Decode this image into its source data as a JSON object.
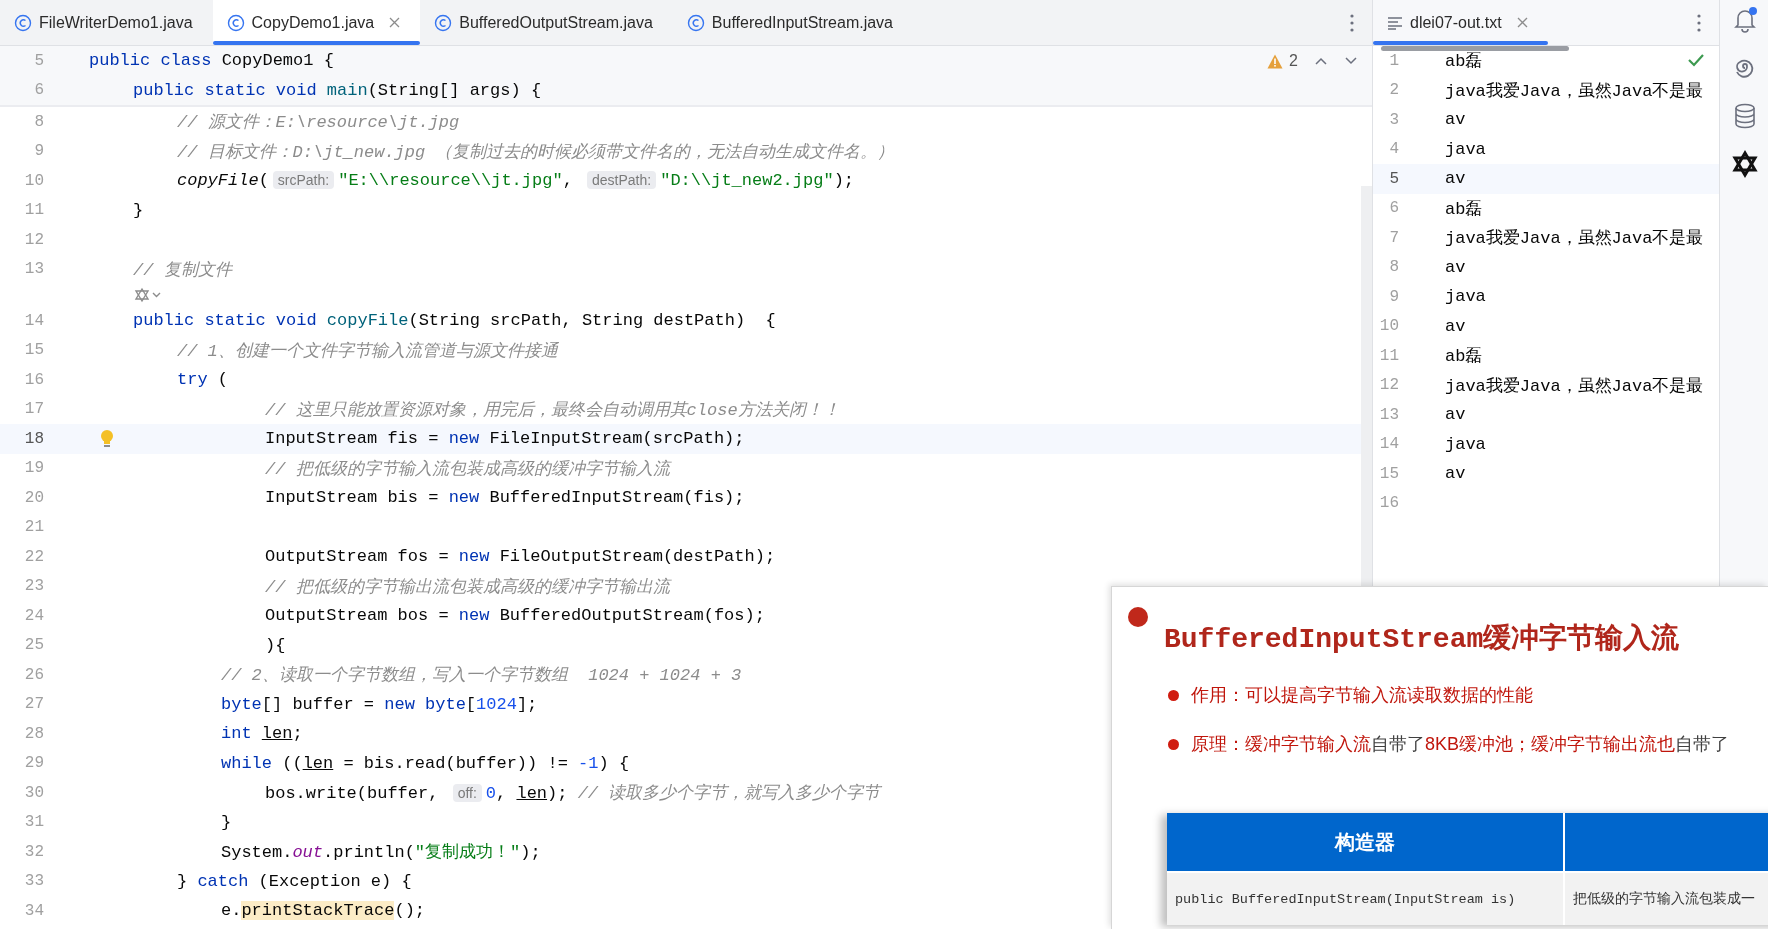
{
  "editor": {
    "tabs": [
      {
        "label": "FileWriterDemo1.java",
        "selected": false,
        "closable": false
      },
      {
        "label": "CopyDemo1.java",
        "selected": true,
        "closable": true
      },
      {
        "label": "BufferedOutputStream.java",
        "selected": false,
        "closable": false
      },
      {
        "label": "BufferedInputStream.java",
        "selected": false,
        "closable": false
      }
    ],
    "warnings": "2",
    "sticky_lines": [
      {
        "kind": "code",
        "number": "5",
        "tokens": [
          {
            "kind": "kw",
            "text": "public class "
          },
          {
            "kind": "t",
            "text": "CopyDemo1 {"
          }
        ]
      },
      {
        "kind": "indent",
        "children": [
          {
            "kind": "code",
            "number": "6",
            "tokens": [
              {
                "kind": "kw",
                "text": "public static void "
              },
              {
                "kind": "fn",
                "text": "main"
              },
              {
                "kind": "t",
                "text": "(String[] args) {"
              }
            ]
          }
        ]
      }
    ],
    "lines": [
      {
        "kind": "indent",
        "children": [
          {
            "kind": "indent",
            "children": [
              {
                "kind": "code",
                "number": "8",
                "current": false,
                "tokens": [
                  {
                    "kind": "cm",
                    "text": "// 源文件：E:\\resource\\jt.jpg"
                  }
                ]
              },
              {
                "kind": "code",
                "number": "9",
                "current": false,
                "tokens": [
                  {
                    "kind": "cm",
                    "text": "// 目标文件：D:\\jt_new.jpg （复制过去的时候必须带文件名的，无法自动生成文件名。）"
                  }
                ]
              },
              {
                "kind": "code",
                "number": "10",
                "current": false,
                "tokens": [
                  {
                    "kind": "it",
                    "text": "copyFile"
                  },
                  {
                    "kind": "t",
                    "text": "("
                  },
                  {
                    "kind": "hint",
                    "text": "srcPath:"
                  },
                  {
                    "kind": "str",
                    "text": "\"E:\\\\resource\\\\jt.jpg\""
                  },
                  {
                    "kind": "t",
                    "text": ", "
                  },
                  {
                    "kind": "hint",
                    "text": "destPath:"
                  },
                  {
                    "kind": "str",
                    "text": "\"D:\\\\jt_new2.jpg\""
                  },
                  {
                    "kind": "t",
                    "text": ");"
                  }
                ]
              }
            ]
          },
          {
            "kind": "code",
            "number": "11",
            "current": false,
            "tokens": [
              {
                "kind": "t",
                "text": "}"
              }
            ]
          },
          {
            "kind": "code",
            "number": "12",
            "current": false
          },
          {
            "kind": "code",
            "number": "13",
            "current": false,
            "tokens": [
              {
                "kind": "cm",
                "text": "// 复制文件"
              }
            ]
          },
          {
            "kind": "inlay"
          },
          {
            "kind": "code",
            "number": "14",
            "current": false,
            "tokens": [
              {
                "kind": "kw",
                "text": "public static void "
              },
              {
                "kind": "fn",
                "text": "copyFile"
              },
              {
                "kind": "t",
                "text": "(String srcPath, String destPath)  {"
              }
            ]
          },
          {
            "kind": "indent",
            "children": [
              {
                "kind": "code",
                "number": "15",
                "current": false,
                "tokens": [
                  {
                    "kind": "cm",
                    "text": "// 1、创建一个文件字节输入流管道与源文件接通"
                  }
                ]
              },
              {
                "kind": "code",
                "number": "16",
                "current": false,
                "tokens": [
                  {
                    "kind": "kw",
                    "text": "try"
                  },
                  {
                    "kind": "t",
                    "text": " ("
                  }
                ]
              },
              {
                "kind": "indent",
                "children": [
                  {
                    "kind": "indent",
                    "children": [
                      {
                        "kind": "code",
                        "number": "17",
                        "current": false,
                        "tokens": [
                          {
                            "kind": "cm",
                            "text": "// 这里只能放置资源对象，用完后，最终会自动调用其close方法关闭！！"
                          }
                        ]
                      },
                      {
                        "kind": "code",
                        "number": "18",
                        "current": true,
                        "tokens": [
                          {
                            "kind": "t",
                            "text": "InputStream fis = "
                          },
                          {
                            "kind": "kw",
                            "text": "new"
                          },
                          {
                            "kind": "t",
                            "text": " FileInputStream(srcPath);"
                          }
                        ]
                      },
                      {
                        "kind": "code",
                        "number": "19",
                        "current": false,
                        "tokens": [
                          {
                            "kind": "cm",
                            "text": "// 把低级的字节输入流包装成高级的缓冲字节输入流"
                          }
                        ]
                      },
                      {
                        "kind": "code",
                        "number": "20",
                        "current": false,
                        "tokens": [
                          {
                            "kind": "t",
                            "text": "InputStream bis = "
                          },
                          {
                            "kind": "kw",
                            "text": "new"
                          },
                          {
                            "kind": "t",
                            "text": " BufferedInputStream(fis);"
                          }
                        ]
                      },
                      {
                        "kind": "code",
                        "number": "21",
                        "current": false
                      },
                      {
                        "kind": "code",
                        "number": "22",
                        "current": false,
                        "tokens": [
                          {
                            "kind": "t",
                            "text": "OutputStream fos = "
                          },
                          {
                            "kind": "kw",
                            "text": "new"
                          },
                          {
                            "kind": "t",
                            "text": " FileOutputStream(destPath);"
                          }
                        ]
                      },
                      {
                        "kind": "code",
                        "number": "23",
                        "current": false,
                        "tokens": [
                          {
                            "kind": "cm",
                            "text": "// 把低级的字节输出流包装成高级的缓冲字节输出流"
                          }
                        ]
                      },
                      {
                        "kind": "code",
                        "number": "24",
                        "current": false,
                        "tokens": [
                          {
                            "kind": "t",
                            "text": "OutputStream bos = "
                          },
                          {
                            "kind": "kw",
                            "text": "new"
                          },
                          {
                            "kind": "t",
                            "text": " BufferedOutputStream(fos);"
                          }
                        ]
                      },
                      {
                        "kind": "code",
                        "number": "25",
                        "current": false,
                        "tokens": [
                          {
                            "kind": "t",
                            "text": "){"
                          }
                        ]
                      }
                    ]
                  }
                ]
              },
              {
                "kind": "indent",
                "children": [
                  {
                    "kind": "code",
                    "number": "26",
                    "current": false,
                    "tokens": [
                      {
                        "kind": "cm",
                        "text": "// 2、读取一个字节数组，写入一个字节数组  1024 + 1024 + 3"
                      }
                    ]
                  },
                  {
                    "kind": "code",
                    "number": "27",
                    "current": false,
                    "tokens": [
                      {
                        "kind": "kw",
                        "text": "byte"
                      },
                      {
                        "kind": "t",
                        "text": "[] buffer = "
                      },
                      {
                        "kind": "kw",
                        "text": "new byte"
                      },
                      {
                        "kind": "t",
                        "text": "["
                      },
                      {
                        "kind": "num",
                        "text": "1024"
                      },
                      {
                        "kind": "t",
                        "text": "];"
                      }
                    ]
                  },
                  {
                    "kind": "code",
                    "number": "28",
                    "current": false,
                    "tokens": [
                      {
                        "kind": "kw",
                        "text": "int "
                      },
                      {
                        "kind": "ul",
                        "text": "len"
                      },
                      {
                        "kind": "t",
                        "text": ";"
                      }
                    ]
                  },
                  {
                    "kind": "code",
                    "number": "29",
                    "current": false,
                    "tokens": [
                      {
                        "kind": "kw",
                        "text": "while"
                      },
                      {
                        "kind": "t",
                        "text": " (("
                      },
                      {
                        "kind": "ul",
                        "text": "len"
                      },
                      {
                        "kind": "t",
                        "text": " = bis.read(buffer)) != "
                      },
                      {
                        "kind": "num",
                        "text": "-1"
                      },
                      {
                        "kind": "t",
                        "text": ") {"
                      }
                    ]
                  },
                  {
                    "kind": "indent",
                    "children": [
                      {
                        "kind": "code",
                        "number": "30",
                        "current": false,
                        "tokens": [
                          {
                            "kind": "t",
                            "text": "bos.write(buffer, "
                          },
                          {
                            "kind": "hint",
                            "text": "off:"
                          },
                          {
                            "kind": "num",
                            "text": "0"
                          },
                          {
                            "kind": "t",
                            "text": ", "
                          },
                          {
                            "kind": "ul",
                            "text": "len"
                          },
                          {
                            "kind": "t",
                            "text": "); "
                          },
                          {
                            "kind": "cm",
                            "text": "// 读取多少个字节，就写入多少个字节"
                          }
                        ]
                      }
                    ]
                  },
                  {
                    "kind": "code",
                    "number": "31",
                    "current": false,
                    "tokens": [
                      {
                        "kind": "t",
                        "text": "}"
                      }
                    ]
                  },
                  {
                    "kind": "code",
                    "number": "32",
                    "current": false,
                    "tokens": [
                      {
                        "kind": "t",
                        "text": "System."
                      },
                      {
                        "kind": "fld",
                        "text": "out"
                      },
                      {
                        "kind": "t",
                        "text": ".println("
                      },
                      {
                        "kind": "str",
                        "text": "\"复制成功！\""
                      },
                      {
                        "kind": "t",
                        "text": ");"
                      }
                    ]
                  }
                ]
              },
              {
                "kind": "code",
                "number": "33",
                "current": false,
                "tokens": [
                  {
                    "kind": "t",
                    "text": "} "
                  },
                  {
                    "kind": "kw",
                    "text": "catch"
                  },
                  {
                    "kind": "t",
                    "text": " (Exception e) {"
                  }
                ]
              },
              {
                "kind": "indent",
                "children": [
                  {
                    "kind": "code",
                    "number": "34",
                    "current": false,
                    "tokens": [
                      {
                        "kind": "t",
                        "text": "e."
                      },
                      {
                        "kind": "hl",
                        "text": "printStackTrace"
                      },
                      {
                        "kind": "t",
                        "text": "();"
                      }
                    ]
                  }
                ]
              }
            ]
          }
        ]
      }
    ]
  },
  "output": {
    "tab": {
      "label": "dlei07-out.txt",
      "selected": true
    },
    "lines": [
      {
        "number": "1",
        "text": "ab磊",
        "current": false
      },
      {
        "number": "2",
        "text": "java我爱Java，虽然Java不是最",
        "current": false
      },
      {
        "number": "3",
        "text": "av",
        "current": false
      },
      {
        "number": "4",
        "text": "java",
        "current": false
      },
      {
        "number": "5",
        "text": "av",
        "current": true
      },
      {
        "number": "6",
        "text": "ab磊",
        "current": false
      },
      {
        "number": "7",
        "text": "java我爱Java，虽然Java不是最",
        "current": false
      },
      {
        "number": "8",
        "text": "av",
        "current": false
      },
      {
        "number": "9",
        "text": "java",
        "current": false
      },
      {
        "number": "10",
        "text": "av",
        "current": false
      },
      {
        "number": "11",
        "text": "ab磊",
        "current": false
      },
      {
        "number": "12",
        "text": "java我爱Java，虽然Java不是最",
        "current": false
      },
      {
        "number": "13",
        "text": "av",
        "current": false
      },
      {
        "number": "14",
        "text": "java",
        "current": false
      },
      {
        "number": "15",
        "text": "av",
        "current": false
      },
      {
        "number": "16",
        "current": false
      }
    ]
  },
  "slide": {
    "title": "BufferedInputStream缓冲字节输入流",
    "bullets": [
      {
        "segments": [
          {
            "text": "作用：可以提高字节输入流读取数据的性能",
            "emphasis": true
          }
        ]
      },
      {
        "segments": [
          {
            "text": "原理：缓冲字节输入流",
            "emphasis": true
          },
          {
            "text": "自带了",
            "emphasis": false
          },
          {
            "text": "8KB缓冲池；缓冲字节输出流也",
            "emphasis": true
          },
          {
            "text": "自带了",
            "emphasis": false
          }
        ]
      }
    ],
    "table": {
      "columns": [
        "构造器"
      ],
      "rows": [
        [
          "public BufferedInputStream(InputStream is)",
          "把低级的字节输入流包装成一"
        ]
      ]
    }
  }
}
